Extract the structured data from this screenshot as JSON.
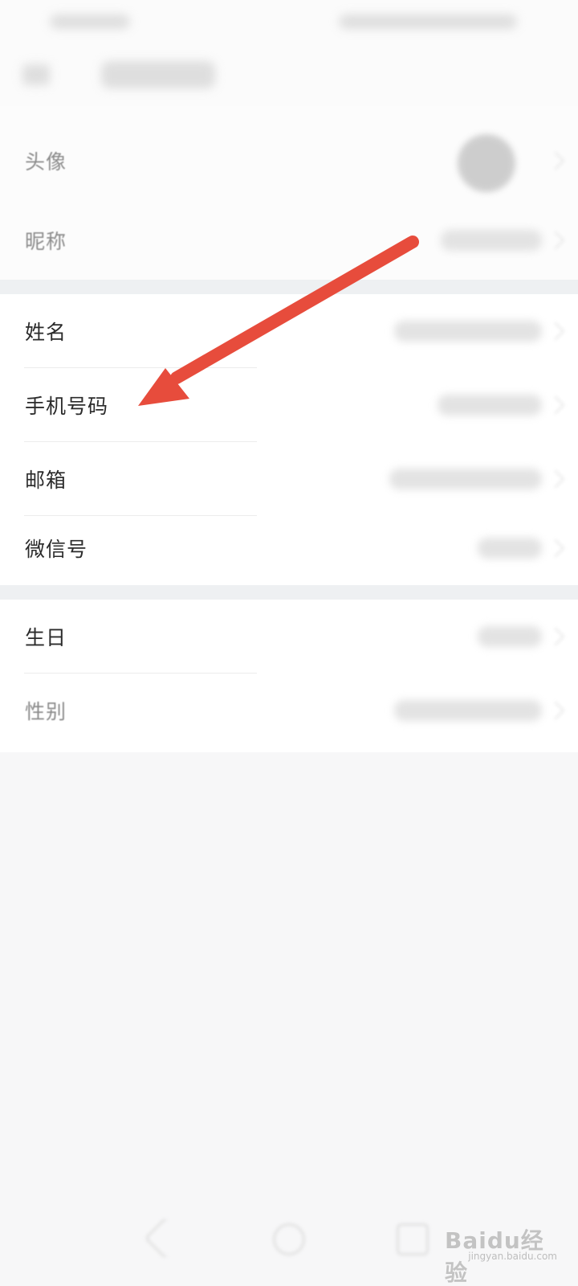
{
  "profile_rows": {
    "avatar_label": "头像",
    "nickname_label": "昵称"
  },
  "info_rows": [
    {
      "label": "姓名"
    },
    {
      "label": "手机号码"
    },
    {
      "label": "邮箱"
    },
    {
      "label": "微信号"
    }
  ],
  "extra_rows": [
    {
      "label": "生日"
    },
    {
      "label": "性别"
    }
  ],
  "watermark": {
    "brand": "Baidu经验",
    "url": "jingyan.baidu.com"
  },
  "accent_color": "#e74c3c"
}
